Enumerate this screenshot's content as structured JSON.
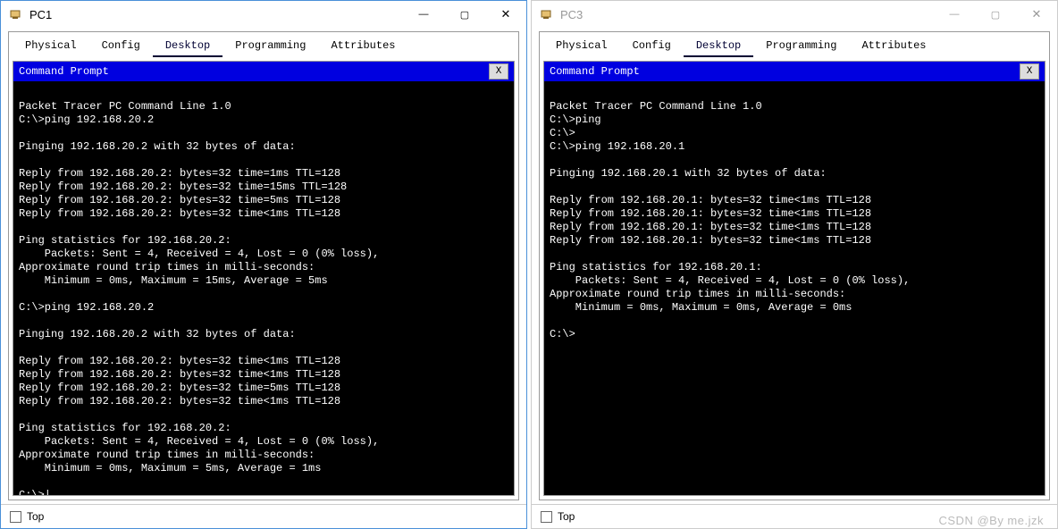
{
  "windows": [
    {
      "title": "PC1",
      "terminal_title": "Command Prompt",
      "close_label": "X",
      "bottom_checkbox_label": "Top",
      "lines": [
        "",
        "Packet Tracer PC Command Line 1.0",
        "C:\\>ping 192.168.20.2",
        "",
        "Pinging 192.168.20.2 with 32 bytes of data:",
        "",
        "Reply from 192.168.20.2: bytes=32 time=1ms TTL=128",
        "Reply from 192.168.20.2: bytes=32 time=15ms TTL=128",
        "Reply from 192.168.20.2: bytes=32 time=5ms TTL=128",
        "Reply from 192.168.20.2: bytes=32 time<1ms TTL=128",
        "",
        "Ping statistics for 192.168.20.2:",
        "    Packets: Sent = 4, Received = 4, Lost = 0 (0% loss),",
        "Approximate round trip times in milli-seconds:",
        "    Minimum = 0ms, Maximum = 15ms, Average = 5ms",
        "",
        "C:\\>ping 192.168.20.2",
        "",
        "Pinging 192.168.20.2 with 32 bytes of data:",
        "",
        "Reply from 192.168.20.2: bytes=32 time<1ms TTL=128",
        "Reply from 192.168.20.2: bytes=32 time<1ms TTL=128",
        "Reply from 192.168.20.2: bytes=32 time=5ms TTL=128",
        "Reply from 192.168.20.2: bytes=32 time<1ms TTL=128",
        "",
        "Ping statistics for 192.168.20.2:",
        "    Packets: Sent = 4, Received = 4, Lost = 0 (0% loss),",
        "Approximate round trip times in milli-seconds:",
        "    Minimum = 0ms, Maximum = 5ms, Average = 1ms",
        "",
        "C:\\>|"
      ]
    },
    {
      "title": "PC3",
      "terminal_title": "Command Prompt",
      "close_label": "X",
      "bottom_checkbox_label": "Top",
      "lines": [
        "",
        "Packet Tracer PC Command Line 1.0",
        "C:\\>ping",
        "C:\\>",
        "C:\\>ping 192.168.20.1",
        "",
        "Pinging 192.168.20.1 with 32 bytes of data:",
        "",
        "Reply from 192.168.20.1: bytes=32 time<1ms TTL=128",
        "Reply from 192.168.20.1: bytes=32 time<1ms TTL=128",
        "Reply from 192.168.20.1: bytes=32 time<1ms TTL=128",
        "Reply from 192.168.20.1: bytes=32 time<1ms TTL=128",
        "",
        "Ping statistics for 192.168.20.1:",
        "    Packets: Sent = 4, Received = 4, Lost = 0 (0% loss),",
        "Approximate round trip times in milli-seconds:",
        "    Minimum = 0ms, Maximum = 0ms, Average = 0ms",
        "",
        "C:\\>"
      ]
    }
  ],
  "tabs": [
    "Physical",
    "Config",
    "Desktop",
    "Programming",
    "Attributes"
  ],
  "active_tab_index": 2,
  "watermark": "CSDN @By me.jzk"
}
